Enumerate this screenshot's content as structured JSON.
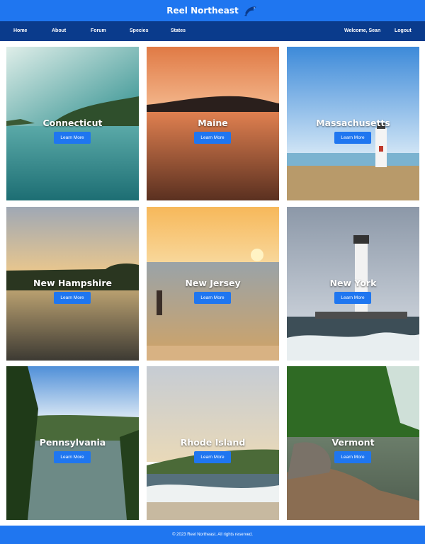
{
  "header": {
    "title": "Reel Northeast",
    "logo_icon": "fish-icon"
  },
  "nav": {
    "left": [
      "Home",
      "About",
      "Forum",
      "Species",
      "States"
    ],
    "welcome": "Welcome, Sean",
    "logout": "Logout"
  },
  "cards": [
    {
      "name": "Connecticut",
      "button": "Learn More"
    },
    {
      "name": "Maine",
      "button": "Learn More"
    },
    {
      "name": "Massachusetts",
      "button": "Learn More"
    },
    {
      "name": "New Hampshire",
      "button": "Learn More"
    },
    {
      "name": "New Jersey",
      "button": "Learn More"
    },
    {
      "name": "New York",
      "button": "Learn More"
    },
    {
      "name": "Pennsylvania",
      "button": "Learn More"
    },
    {
      "name": "Rhode Island",
      "button": "Learn More"
    },
    {
      "name": "Vermont",
      "button": "Learn More"
    }
  ],
  "footer": {
    "text": "© 2023 Reel Northeast. All rights reserved."
  },
  "colors": {
    "primary": "#1f76f0",
    "nav": "#0a3b8c"
  }
}
